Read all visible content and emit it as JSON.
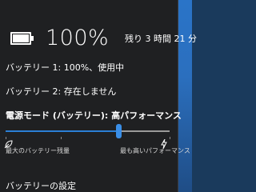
{
  "battery": {
    "icon": "battery-full-icon",
    "percent": "100%",
    "charge_fraction": 1.0,
    "remaining": "残り 3 時間 21 分"
  },
  "details": {
    "battery1": "バッテリー 1: 100%、使用中",
    "battery2": "バッテリー 2: 存在しません"
  },
  "power_mode": {
    "title": "電源モード (バッテリー): 高パフォーマンス",
    "slider_value": 0.69,
    "left_icon": "leaf-icon",
    "right_icon": "lightning-bolt-icon",
    "left_caption": "最大のバッテリー残量",
    "right_caption": "最も高いパフォーマンス"
  },
  "links": {
    "settings": "バッテリーの設定"
  },
  "colors": {
    "accent": "#2b7fd6",
    "flyout_bg": "#1f2022"
  }
}
